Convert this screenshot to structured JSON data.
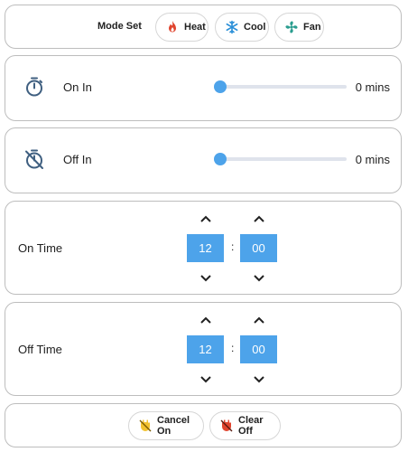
{
  "mode": {
    "label": "Mode Set",
    "buttons": [
      {
        "label": "Heat",
        "icon": "fire-icon",
        "color": "#e0452f"
      },
      {
        "label": "Cool",
        "icon": "snowflake-icon",
        "color": "#2a8fd8"
      },
      {
        "label": "Fan",
        "icon": "fan-icon",
        "color": "#2a9d8f"
      }
    ]
  },
  "on_in": {
    "label": "On In",
    "value": "0 mins",
    "slider_fraction": 0,
    "icon": "timer-icon"
  },
  "off_in": {
    "label": "Off In",
    "value": "0 mins",
    "slider_fraction": 0,
    "icon": "timer-off-icon"
  },
  "on_time": {
    "label": "On Time",
    "hour": "12",
    "minute": "00",
    "separator": ":"
  },
  "off_time": {
    "label": "Off Time",
    "hour": "12",
    "minute": "00",
    "separator": ":"
  },
  "actions": [
    {
      "label": "Cancel On",
      "icon": "cancel-on-icon",
      "color": "#f2c230"
    },
    {
      "label": "Clear Off",
      "icon": "clear-off-icon",
      "color": "#e0452f"
    }
  ],
  "colors": {
    "accent": "#4da3ea",
    "icon_blue": "#3f5f80"
  }
}
